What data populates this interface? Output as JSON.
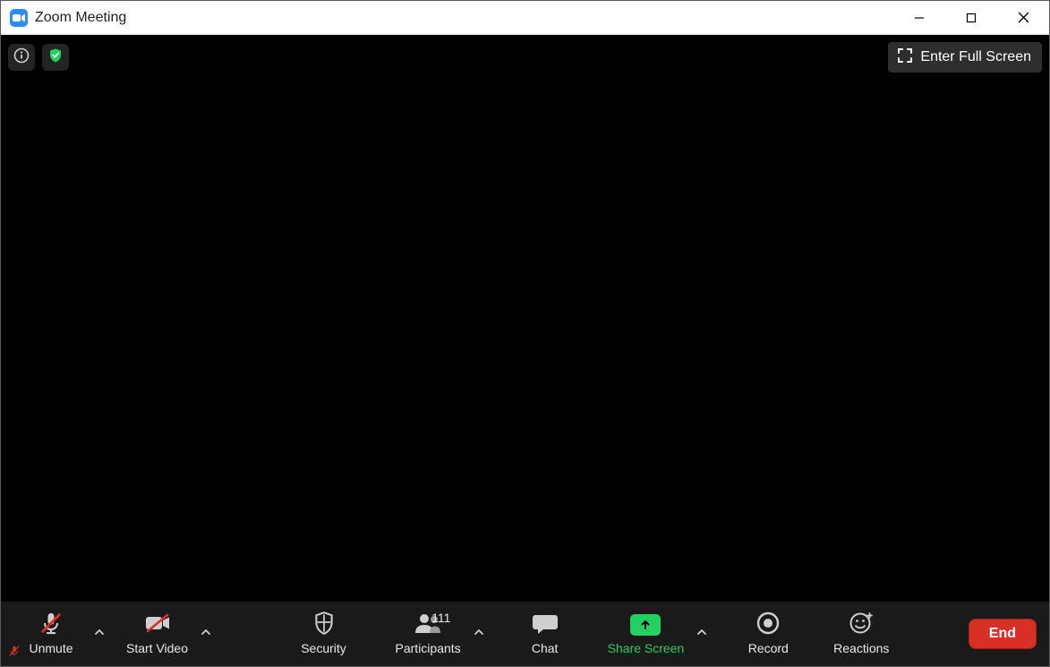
{
  "window": {
    "title": "Zoom Meeting"
  },
  "overlay": {
    "fullscreen_label": "Enter Full Screen"
  },
  "toolbar": {
    "unmute_label": "Unmute",
    "start_video_label": "Start Video",
    "security_label": "Security",
    "participants_label": "Participants",
    "participants_count": "111",
    "chat_label": "Chat",
    "share_label": "Share Screen",
    "record_label": "Record",
    "reactions_label": "Reactions",
    "end_label": "End"
  },
  "colors": {
    "accent_green": "#23D160",
    "end_red": "#d93025",
    "zoom_blue": "#2D8CFF"
  }
}
